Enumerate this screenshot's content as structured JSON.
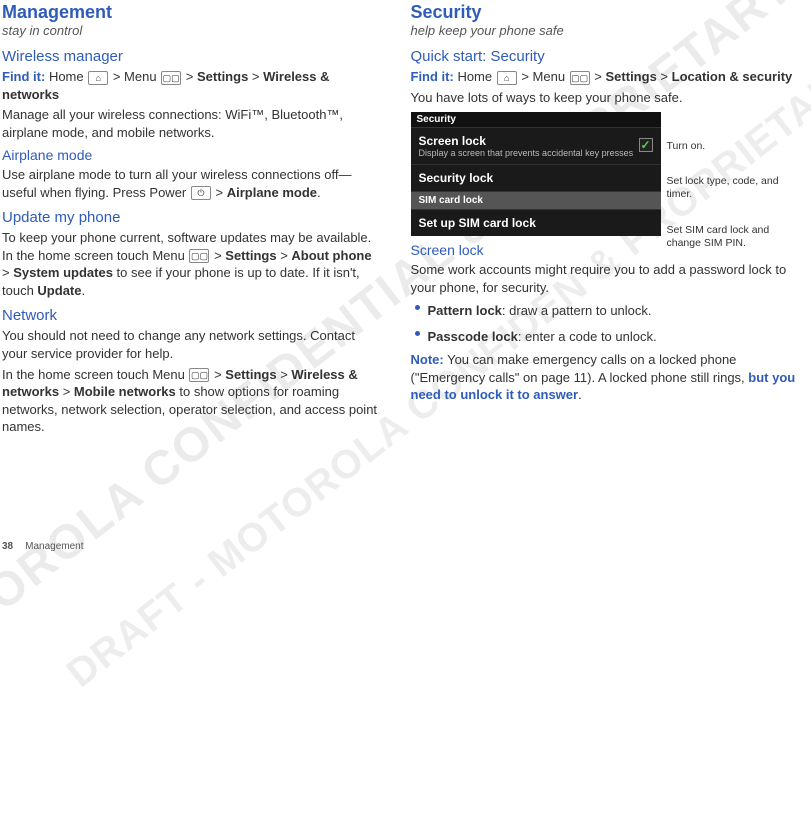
{
  "left": {
    "h1": "Management",
    "subtitle": "stay in control",
    "wireless": {
      "h2": "Wireless manager",
      "findit": "Find it:",
      "path1": " Home ",
      "path2": " > Menu ",
      "path3": " > ",
      "settings": "Settings",
      "gt": " > ",
      "wn": "Wireless & networks",
      "desc": "Manage all your wireless connections: WiFi™, Bluetooth™, airplane mode, and mobile networks."
    },
    "airplane": {
      "h3": "Airplane mode",
      "desc1": "Use airplane mode to turn all your wireless connections off—useful when flying. Press Power ",
      "desc2": " > ",
      "apm": "Airplane mode",
      "desc3": "."
    },
    "update": {
      "h2": "Update my phone",
      "p1a": "To keep your phone current, software updates may be available. In the home screen touch Menu ",
      "p1b": " > ",
      "settings": "Settings",
      "gt": " > ",
      "about": "About phone",
      "gt2": " > ",
      "sysu": "System updates",
      "p1c": " to see if your phone is up to date. If it isn't, touch ",
      "updatebtn": "Update",
      "p1d": "."
    },
    "network": {
      "h2": "Network",
      "p1": "You should not need to change any network settings. Contact your service provider for help.",
      "p2a": "In the home screen touch Menu ",
      "p2b": " > ",
      "settings": "Settings",
      "gt": " > ",
      "wn": "Wireless & networks",
      "gt2": " > ",
      "mn": "Mobile networks",
      "p2c": " to show options for roaming networks, network selection, operator selection, and access point names."
    }
  },
  "right": {
    "h1": "Security",
    "subtitle": "help keep your phone safe",
    "quick": {
      "h2": "Quick start: Security",
      "findit": "Find it:",
      "path1": " Home ",
      "path2": " > Menu ",
      "path3": " > ",
      "settings": "Settings",
      "gt": " > ",
      "ls": "Location & security",
      "desc": "You have lots of ways to keep your phone safe."
    },
    "phoneshot": {
      "bar": "Security",
      "item1_title": "Screen lock",
      "item1_sub": "Display a screen that prevents accidental key presses",
      "item2_title": "Security lock",
      "grayhdr": "SIM card lock",
      "item3_title": "Set up SIM card lock",
      "annot1": "Turn on.",
      "annot2": "Set lock type, code, and timer.",
      "annot3": "Set SIM card lock and change SIM PIN."
    },
    "screenlock": {
      "h3": "Screen lock",
      "p1": "Some work accounts might require you to add a password lock to your phone, for security.",
      "b1_label": "Pattern lock",
      "b1_rest": ": draw a pattern to unlock.",
      "b2_label": "Passcode lock",
      "b2_rest": ": enter a code to unlock.",
      "note": "Note:",
      "note_rest": " You can make emergency calls on a locked phone (\"Emergency calls\" on page 11). A locked phone still rings, ",
      "note_strong": "but you need to unlock it to answer",
      "note_end": "."
    }
  },
  "footer": {
    "page": "38",
    "section": "Management"
  },
  "watermark": "DRAFT - MOTOROLA CONFIDENTIAL\n& PROPRIETARY INFORMATION",
  "watermark2": "DRAFT - MOTOROLA CONFIDEN\n& PROPRIETARY INFORMATION"
}
